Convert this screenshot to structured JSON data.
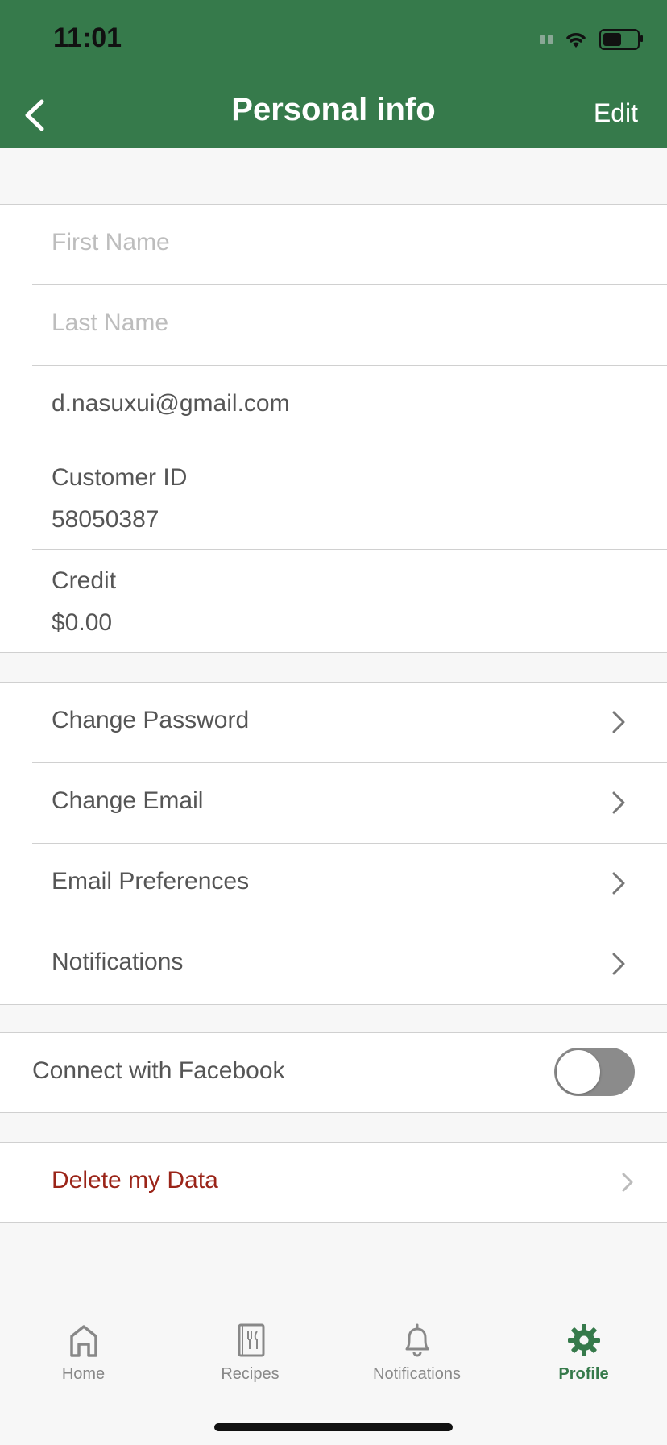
{
  "status_bar": {
    "time": "11:01"
  },
  "header": {
    "title": "Personal info",
    "edit_label": "Edit"
  },
  "profile": {
    "first_name_placeholder": "First Name",
    "last_name_placeholder": "Last Name",
    "email": "d.nasuxui@gmail.com",
    "customer_id_label": "Customer ID",
    "customer_id": "58050387",
    "credit_label": "Credit",
    "credit": "$0.00"
  },
  "settings": {
    "items": [
      {
        "label": "Change Password"
      },
      {
        "label": "Change Email"
      },
      {
        "label": "Email Preferences"
      },
      {
        "label": "Notifications"
      }
    ]
  },
  "facebook": {
    "label": "Connect with Facebook",
    "enabled": false
  },
  "delete": {
    "label": "Delete my Data"
  },
  "tabbar": {
    "tabs": [
      {
        "label": "Home",
        "icon": "home-icon"
      },
      {
        "label": "Recipes",
        "icon": "recipe-book-icon"
      },
      {
        "label": "Notifications",
        "icon": "bell-icon"
      },
      {
        "label": "Profile",
        "icon": "gear-icon"
      }
    ],
    "active": "Profile"
  },
  "colors": {
    "brand": "#367a4b",
    "danger": "#9a2418",
    "text": "#555555"
  }
}
